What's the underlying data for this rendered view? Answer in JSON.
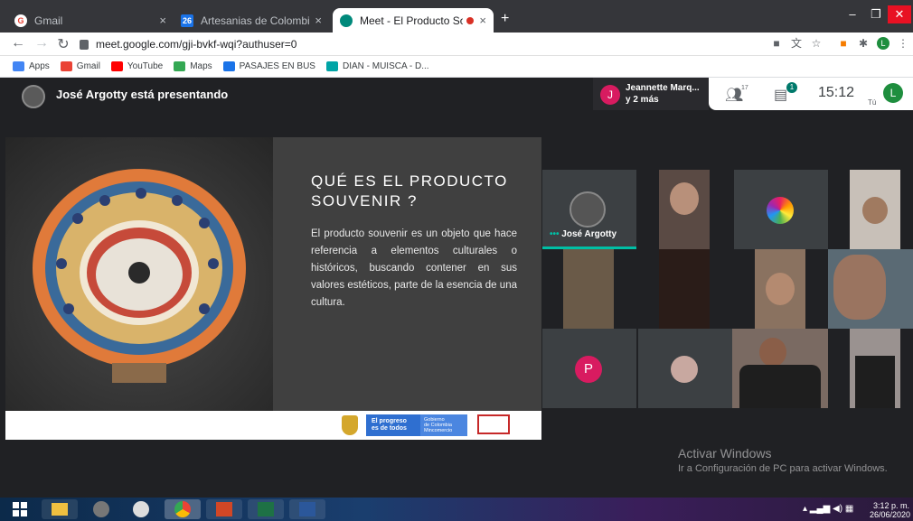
{
  "browser": {
    "tabs": [
      {
        "label": "Gmail",
        "icon": "gmail-icon",
        "close": "×"
      },
      {
        "label": "Artesanias de Colombia S.A. - Ca",
        "icon": "calendar-icon",
        "close": "×"
      },
      {
        "label": "Meet - El Producto Souvenir",
        "icon": "meet-icon",
        "close": "×"
      }
    ],
    "new_tab": "+",
    "url": "meet.google.com/gji-bvkf-wqi?authuser=0",
    "profile_initial": "L",
    "bookmarks": [
      {
        "label": "Apps",
        "color": "#4285f4"
      },
      {
        "label": "Gmail",
        "color": "#ea4335"
      },
      {
        "label": "YouTube",
        "color": "#ff0000"
      },
      {
        "label": "Maps",
        "color": "#34a853"
      },
      {
        "label": "PASAJES EN BUS",
        "color": "#1a73e8"
      },
      {
        "label": "DIAN - MUISCA - D...",
        "color": "#00a4a6"
      }
    ]
  },
  "meet": {
    "presenter_label": "José Argotty está presentando",
    "others_initial": "J",
    "others_name": "Jeannette Marq...",
    "others_more": "y 2 más",
    "participants_count": "17",
    "chat_badge": "1",
    "clock": "15:12",
    "me_initial": "L",
    "me_label": "Tú",
    "slide": {
      "title": "QUÉ ES EL PRODUCTO SOUVENIR ?",
      "body": "El producto souvenir es un objeto que hace referencia a elementos culturales o históricos, buscando contener en sus valores estéticos, parte de la esencia de una cultura.",
      "gov_line1": "El progreso",
      "gov_line2": "es de todos",
      "gov_small1": "Gobierno",
      "gov_small2": "de Colombia",
      "gov_small3": "Mincomercio"
    },
    "tiles": {
      "jose_name": "José Argotty",
      "p_initial": "P"
    },
    "watermark_title": "Activar Windows",
    "watermark_sub": "Ir a Configuración de PC para activar Windows."
  },
  "taskbar": {
    "time": "3:12 p. m.",
    "date": "26/06/2020"
  }
}
